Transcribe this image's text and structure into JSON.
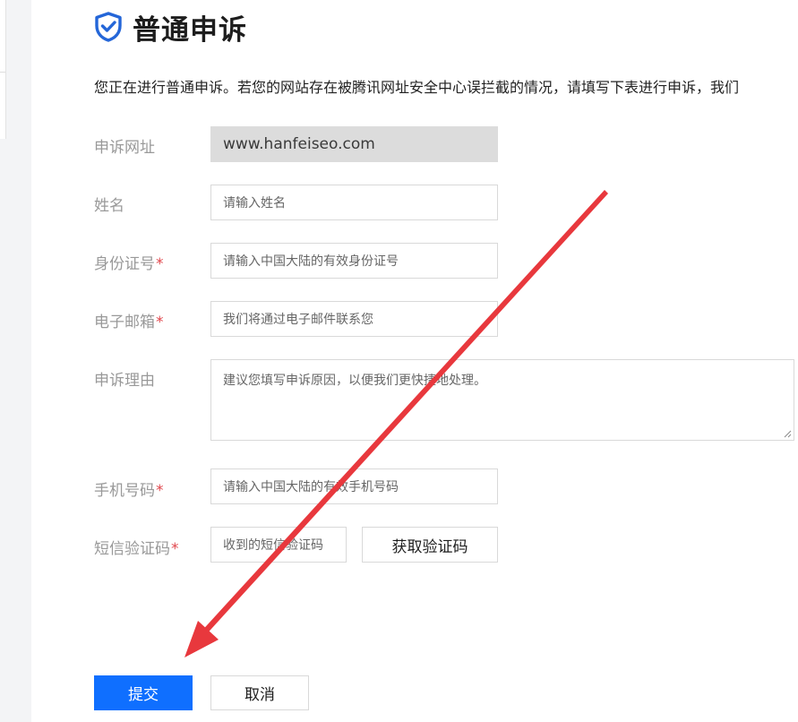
{
  "header": {
    "title": "普通申诉",
    "intro": "您正在进行普通申诉。若您的网站存在被腾讯网址安全中心误拦截的情况，请填写下表进行申诉，我们"
  },
  "form": {
    "url": {
      "label": "申诉网址",
      "value": "www.hanfeiseo.com"
    },
    "name": {
      "label": "姓名",
      "placeholder": "请输入姓名"
    },
    "id_number": {
      "label": "身份证号",
      "required_mark": "*",
      "placeholder": "请输入中国大陆的有效身份证号"
    },
    "email": {
      "label": "电子邮箱",
      "required_mark": "*",
      "placeholder": "我们将通过电子邮件联系您"
    },
    "reason": {
      "label": "申诉理由",
      "placeholder": "建议您填写申诉原因，以便我们更快捷地处理。"
    },
    "phone": {
      "label": "手机号码",
      "required_mark": "*",
      "placeholder": "请输入中国大陆的有效手机号码"
    },
    "sms_code": {
      "label": "短信验证码",
      "required_mark": "*",
      "placeholder": "收到的短信验证码",
      "get_code_label": "获取验证码"
    }
  },
  "actions": {
    "submit_label": "提交",
    "cancel_label": "取消"
  },
  "colors": {
    "primary_button": "#0f6fff",
    "required_mark": "#e0454b",
    "annotation_arrow": "#e8383d",
    "label_text": "#999999",
    "readonly_field_bg": "#dcdcdc"
  },
  "icons": {
    "title_icon": "shield-check-icon"
  }
}
